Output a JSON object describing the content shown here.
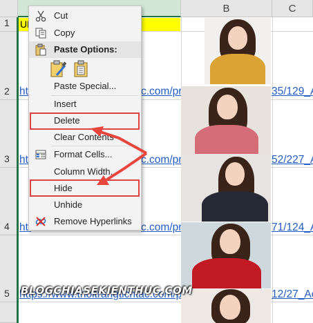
{
  "sheet": {
    "columns": [
      {
        "label": "",
        "selected": true
      },
      {
        "label": "B",
        "selected": false
      },
      {
        "label": "C",
        "selected": false
      }
    ],
    "rows": [
      {
        "num": "1",
        "content": "UR"
      },
      {
        "num": "2",
        "link_left": "htt",
        "link_mid": "c.com/pr",
        "link_right": "35/129_A"
      },
      {
        "num": "3",
        "link_left": "htt",
        "link_mid": "c.com/pr",
        "link_right": "52/227_A"
      },
      {
        "num": "4",
        "link_left": "htt",
        "link_mid": "c.com/pr",
        "link_right": "71/124_A"
      },
      {
        "num": "5",
        "link_full": "https://www.thoitrangtichtac.com/pr",
        "link_right": "12/27_Ao"
      }
    ],
    "header_fill_color": "#ffff00",
    "selection_color": "#217346",
    "link_color": "#1f5cc4"
  },
  "context_menu": {
    "items": [
      {
        "label": "Cut",
        "icon": "scissors-icon"
      },
      {
        "label": "Copy",
        "icon": "copy-icon"
      },
      {
        "label": "Paste Options:",
        "icon": "paste-icon"
      },
      {
        "label": "Paste Special..."
      },
      {
        "label": "Insert"
      },
      {
        "label": "Delete"
      },
      {
        "label": "Clear Contents"
      },
      {
        "label": "Format Cells...",
        "icon": "format-cells-icon"
      },
      {
        "label": "Column Width..."
      },
      {
        "label": "Hide"
      },
      {
        "label": "Unhide"
      },
      {
        "label": "Remove Hyperlinks",
        "icon": "remove-hyperlink-icon"
      }
    ],
    "highlight_color": "#e04040"
  },
  "watermark": "BLOGCHIASEKIENTHUC.COM"
}
